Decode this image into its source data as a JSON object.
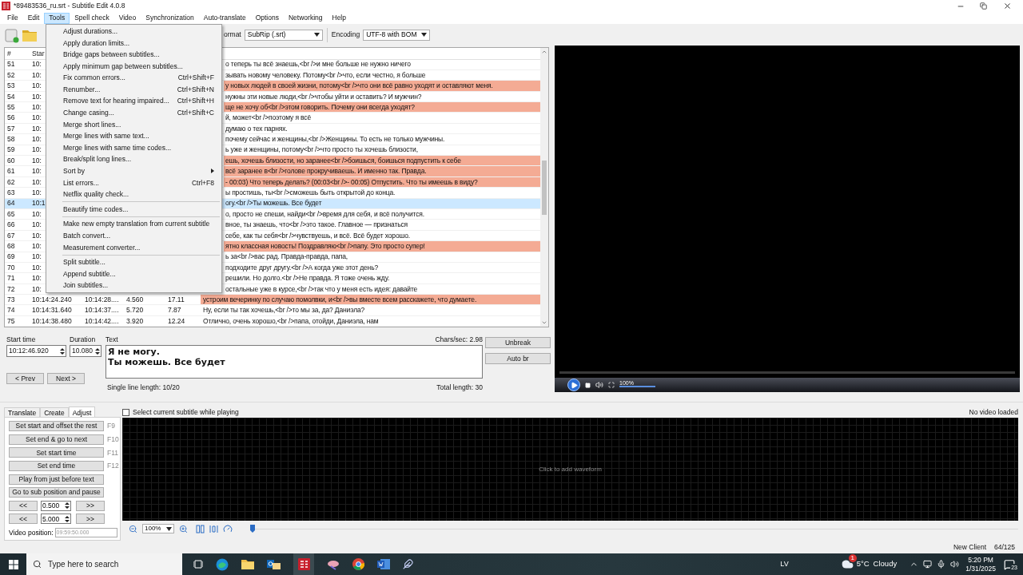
{
  "window": {
    "title": "*89483536_ru.srt - Subtitle Edit 4.0.8"
  },
  "menu": [
    {
      "label": "File",
      "selected": false
    },
    {
      "label": "Edit",
      "selected": false
    },
    {
      "label": "Tools",
      "selected": true
    },
    {
      "label": "Spell check",
      "selected": false
    },
    {
      "label": "Video",
      "selected": false
    },
    {
      "label": "Synchronization",
      "selected": false
    },
    {
      "label": "Auto-translate",
      "selected": false
    },
    {
      "label": "Options",
      "selected": false
    },
    {
      "label": "Networking",
      "selected": false
    },
    {
      "label": "Help",
      "selected": false
    }
  ],
  "tools_menu": [
    {
      "kind": "item",
      "label": "Adjust durations..."
    },
    {
      "kind": "item",
      "label": "Apply duration limits..."
    },
    {
      "kind": "item",
      "label": "Bridge gaps between subtitles..."
    },
    {
      "kind": "item",
      "label": "Apply minimum gap between subtitles..."
    },
    {
      "kind": "item",
      "label": "Fix common errors...",
      "shortcut": "Ctrl+Shift+F"
    },
    {
      "kind": "item",
      "label": "Renumber...",
      "shortcut": "Ctrl+Shift+N"
    },
    {
      "kind": "item",
      "label": "Remove text for hearing impaired...",
      "shortcut": "Ctrl+Shift+H"
    },
    {
      "kind": "item",
      "label": "Change casing...",
      "shortcut": "Ctrl+Shift+C"
    },
    {
      "kind": "item",
      "label": "Merge short lines..."
    },
    {
      "kind": "item",
      "label": "Merge lines with same text..."
    },
    {
      "kind": "item",
      "label": "Merge lines with same time codes..."
    },
    {
      "kind": "item",
      "label": "Break/split long lines..."
    },
    {
      "kind": "submenu",
      "label": "Sort by"
    },
    {
      "kind": "item",
      "label": "List errors...",
      "shortcut": "Ctrl+F8"
    },
    {
      "kind": "item",
      "label": "Netflix quality check..."
    },
    {
      "kind": "separator"
    },
    {
      "kind": "item",
      "label": "Beautify time codes..."
    },
    {
      "kind": "separator"
    },
    {
      "kind": "item",
      "label": "Make new empty translation from current subtitle"
    },
    {
      "kind": "item",
      "label": "Batch convert..."
    },
    {
      "kind": "item",
      "label": "Measurement converter..."
    },
    {
      "kind": "separator"
    },
    {
      "kind": "item",
      "label": "Split subtitle..."
    },
    {
      "kind": "item",
      "label": "Append subtitle..."
    },
    {
      "kind": "item",
      "label": "Join subtitles..."
    }
  ],
  "toolbar": {
    "format_label": "ormat",
    "format": "SubRip (.srt)",
    "encoding_label": "Encoding",
    "encoding": "UTF-8 with BOM"
  },
  "table": {
    "columns": [
      "#",
      "Star"
    ],
    "rows": [
      {
        "number": "51",
        "start": "10:",
        "text": "о теперь ты всё знаешь,<br />и мне больше не нужно ничего",
        "error": false,
        "selected": false
      },
      {
        "number": "52",
        "start": "10:",
        "text": "зывать новому человеку. Потому<br />что, если честно, я больше",
        "error": false,
        "selected": false
      },
      {
        "number": "53",
        "start": "10:",
        "text": "у новых людей в своей жизни, потому<br />что они всё равно уходят и оставляют меня.",
        "error": true,
        "selected": false
      },
      {
        "number": "54",
        "start": "10:",
        "text": "нужны эти новые люди,<br />чтобы уйти и оставить? И мужчин?",
        "error": false,
        "selected": false
      },
      {
        "number": "55",
        "start": "10:",
        "text": "ще не хочу об<br />этом говорить. Почему они всегда уходят?",
        "error": true,
        "selected": false
      },
      {
        "number": "56",
        "start": "10:",
        "text": "й, может<br />поэтому я всё",
        "error": false,
        "selected": false
      },
      {
        "number": "57",
        "start": "10:",
        "text": "думаю о тех парнях.",
        "error": false,
        "selected": false
      },
      {
        "number": "58",
        "start": "10:",
        "text": "почему сейчас и женщины,<br />Женщины. То есть не только мужчины.",
        "error": false,
        "selected": false
      },
      {
        "number": "59",
        "start": "10:",
        "text": "ь уже и женщины, потому<br />что просто ты хочешь близости,",
        "error": false,
        "selected": false
      },
      {
        "number": "60",
        "start": "10:",
        "text": "ешь, хочешь близости, но заранее<br />боишься, боишься подпустить к себе",
        "error": true,
        "selected": false
      },
      {
        "number": "61",
        "start": "10:",
        "text": "всё заранее в<br />голове прокручиваешь. И именно так. Правда.",
        "error": true,
        "selected": false
      },
      {
        "number": "62",
        "start": "10:",
        "text": "- 00:03) Что теперь делать? (00:03<br />- 00:05) Отпустить. Что ты имеешь в виду?",
        "error": true,
        "selected": false
      },
      {
        "number": "63",
        "start": "10:",
        "text": "ы простишь, ты<br />сможешь быть открытой до конца.",
        "error": false,
        "selected": false
      },
      {
        "number": "64",
        "start": "10:1",
        "text": "огу.<br />Ты можешь. Все будет",
        "error": false,
        "selected": true
      },
      {
        "number": "65",
        "start": "10:",
        "text": "о, просто не спеши, найди<br />время для себя, и всё получится.",
        "error": false,
        "selected": false
      },
      {
        "number": "66",
        "start": "10:",
        "text": "вное, ты знаешь, что<br />это такое. Главное — признаться",
        "error": false,
        "selected": false
      },
      {
        "number": "67",
        "start": "10:",
        "text": "себе, как ты себя<br />чувствуешь, и всё. Всё будет хорошо.",
        "error": false,
        "selected": false
      },
      {
        "number": "68",
        "start": "10:",
        "text": "ятно классная новость! Поздравляю<br />папу. Это просто супер!",
        "error": true,
        "selected": false
      },
      {
        "number": "69",
        "start": "10:",
        "text": "ь за<br />вас рад. Правда-правда, папа,",
        "error": false,
        "selected": false
      },
      {
        "number": "70",
        "start": "10:",
        "text": "подходите друг другу.<br />А когда уже этот день?",
        "error": false,
        "selected": false
      },
      {
        "number": "71",
        "start": "10:",
        "text": "решили. Но долго.<br />Не правда. Я тоже очень жду.",
        "error": false,
        "selected": false
      },
      {
        "number": "72",
        "start": "10:",
        "text": "остальные уже в курсе,<br />так что у меня есть идея: давайте",
        "error": false,
        "selected": false
      },
      {
        "number": "73",
        "start": "10:14:24.240",
        "end": "10:14:28....",
        "duration": "4.560",
        "cps": "17.11",
        "text": "устроим вечеринку по случаю помолвки, и<br />вы вместе всем расскажете, что думаете.",
        "error": true,
        "selected": false
      },
      {
        "number": "74",
        "start": "10:14:31.640",
        "end": "10:14:37....",
        "duration": "5.720",
        "cps": "7.87",
        "text": "Ну, если ты так хочешь,<br />то мы за, да? Даниэла?",
        "error": false,
        "selected": false
      },
      {
        "number": "75",
        "start": "10:14:38.480",
        "end": "10:14:42....",
        "duration": "3.920",
        "cps": "12.24",
        "text": "Отлично, очень хорошо,<br />папа, отойди, Даниэла, нам",
        "error": false,
        "selected": false
      }
    ]
  },
  "editor": {
    "start_label": "Start time",
    "start": "10:12:46.920",
    "duration_label": "Duration",
    "duration": "10.080",
    "text_label": "Text",
    "cps": "Chars/sec: 2.98",
    "lines": [
      "Я не могу.",
      "Ты можешь. Все будет"
    ],
    "buttons": [
      "Unbreak",
      "Auto br"
    ],
    "prev": "< Prev",
    "next": "Next >",
    "single_line": "Single line length: 10/20",
    "total": "Total length: 30"
  },
  "video": {
    "volume": {
      "reading": "100%",
      "level": 1
    }
  },
  "adjust": {
    "tabs": [
      {
        "label": "Translate",
        "selected": false
      },
      {
        "label": "Create",
        "selected": false
      },
      {
        "label": "Adjust",
        "selected": true
      }
    ],
    "buttons": [
      {
        "label": "Set start and offset the rest",
        "shortcut": "F9"
      },
      {
        "label": "Set end & go to next",
        "shortcut": "F10"
      },
      {
        "label": "Set start time",
        "shortcut": "F11"
      },
      {
        "label": "Set end time",
        "shortcut": "F12"
      },
      {
        "label": "Play from just before text"
      },
      {
        "label": "Go to sub position and pause"
      }
    ],
    "spins": [
      {
        "back": "<<",
        "value": "0.500",
        "forward": ">>"
      },
      {
        "back": "<<",
        "value": "5.000",
        "forward": ">>"
      }
    ],
    "video_position_label": "Video position:",
    "video_position": "09:59:50.000"
  },
  "waveform": {
    "checkbox": {
      "label": "Select current subtitle while playing",
      "checked": false
    },
    "status": "No video loaded",
    "hint": "Click to add waveform",
    "zoom": "100%",
    "position": {
      "level": 0
    }
  },
  "status_bar": {
    "left": "New Client",
    "right": "64/125"
  },
  "taskbar": {
    "search_placeholder": "Type here to search",
    "language": "LV",
    "weather_badge": "1",
    "temperature": "5°C",
    "weather": "Cloudy",
    "time": "5:20 PM",
    "date": "1/31/2025",
    "notifications": "23"
  }
}
